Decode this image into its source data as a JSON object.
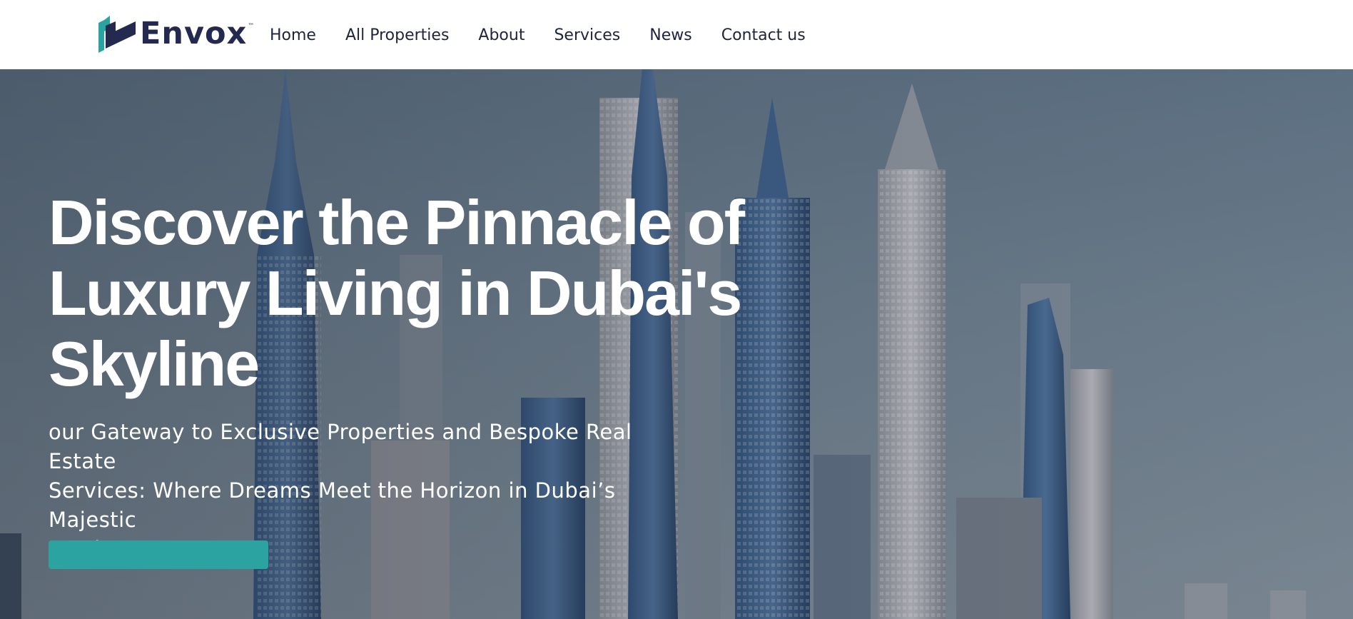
{
  "header": {
    "logo_text": "Envox",
    "logo_tm": "™",
    "nav": [
      "Home",
      "All Properties",
      "About",
      "Services",
      "News",
      "Contact us"
    ]
  },
  "hero": {
    "title_lines": [
      "Discover the Pinnacle of",
      "Luxury Living in Dubai's",
      "Skyline"
    ],
    "subtitle_lines": [
      "our Gateway to Exclusive Properties and Bespoke Real Estate",
      "Services: Where Dreams Meet the Horizon in Dubai’s Majestic",
      "Landscape"
    ]
  },
  "colors": {
    "brand_navy": "#23294f",
    "brand_teal": "#2aa3a1",
    "nav_text": "#1e2440"
  },
  "icons": {
    "logo": "envox-logo-mark"
  }
}
